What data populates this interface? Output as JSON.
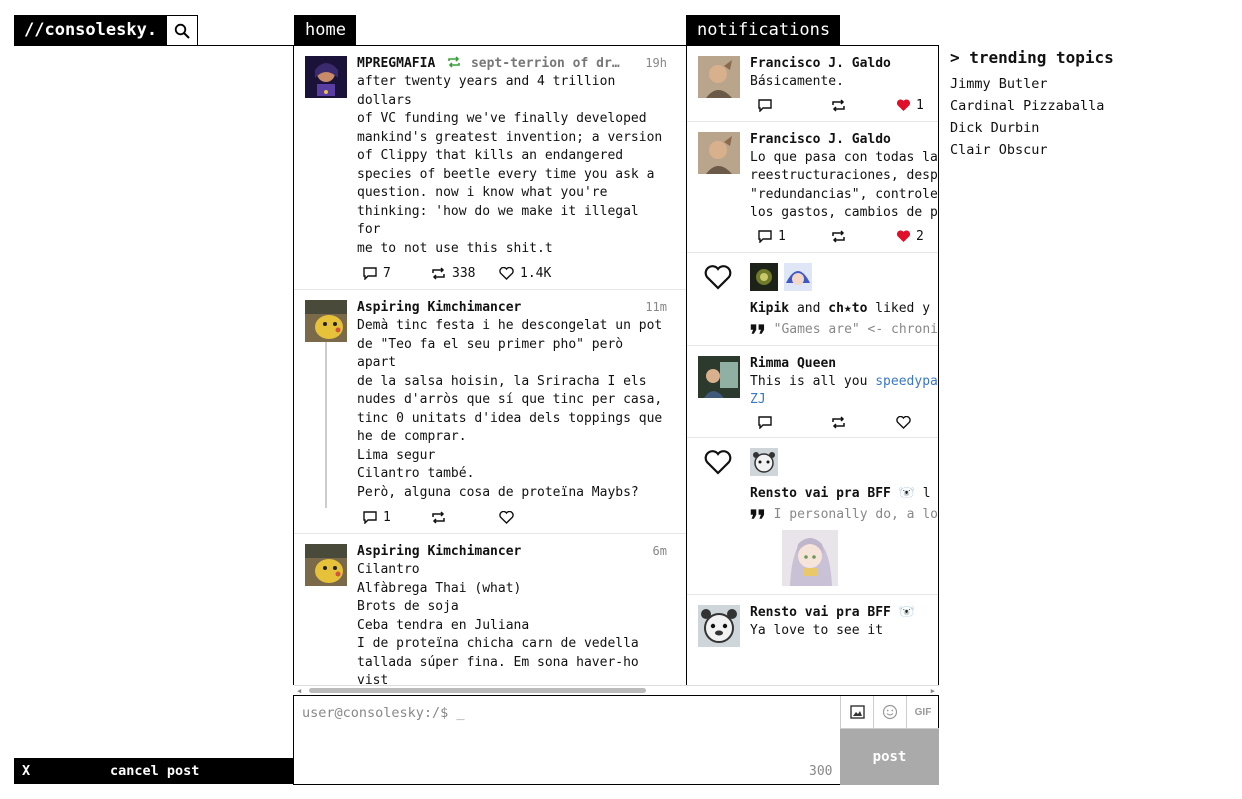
{
  "app": {
    "logo": "//consolesky."
  },
  "columns": {
    "home": "home",
    "notifications": "notifications"
  },
  "home": {
    "posts": [
      {
        "author": "MPREGMAFIA",
        "repost_by": "sept-terrion of dr…",
        "time": "19h",
        "body": "after twenty years and 4 trillion dollars\nof VC funding we've finally developed\nmankind's greatest invention; a version\nof Clippy that kills an endangered\nspecies of beetle every time you ask a\nquestion. now i know what you're\nthinking: 'how do we make it illegal for\nme to not use this shit.t",
        "replies": "7",
        "reposts": "338",
        "likes": "1.4K"
      },
      {
        "author": "Aspiring Kimchimancer",
        "time": "11m",
        "body": "Demà tinc festa i he descongelat un pot\nde \"Teo fa el seu primer pho\" però apart\nde la salsa hoisin, la Sriracha I els\nnudes d'arròs que sí que tinc per casa,\ntinc 0 unitats d'idea dels toppings que\nhe de comprar.\nLima segur\nCilantro també.\nPerò, alguna cosa de proteïna Maybs?",
        "replies": "1",
        "reposts": "",
        "likes": ""
      },
      {
        "author": "Aspiring Kimchimancer",
        "time": "6m",
        "body": "Cilantro\nAlfàbrega Thai (what)\nBrots de soja\nCeba tendra en Juliana\nI de proteïna chicha carn de vedella\ntallada súper fina. Em sona haver-ho vist\nen algún lloc.\nDe moment sembla fàcil.\nMenys per lo de l'alfabrega Thai."
      }
    ]
  },
  "notifications": {
    "items": [
      {
        "author": "Francisco J. Galdo",
        "text": "Básicamente.",
        "replies": "",
        "likes": "1"
      },
      {
        "author": "Francisco J. Galdo",
        "text": "Lo que pasa con todas las\nreestructuraciones, despi\n\"redundancias\", controles\nlos gastos, cambios de po",
        "replies": "1",
        "likes": "2"
      },
      {
        "user1": "Kipik",
        "and": "and",
        "user2": "ch★to",
        "action": "liked y",
        "quote": "\"Games are\" <- chroni"
      },
      {
        "author": "Rimma Queen",
        "text": "This is all you ",
        "link": "speedypape",
        "link2": "ZJ"
      },
      {
        "user1": "Rensto vai pra BFF 🐻‍❄️",
        "action": "l",
        "quote": "I personally do, a lo"
      },
      {
        "author": "Rensto vai pra BFF 🐻‍❄️",
        "text": "Ya love to see it"
      }
    ]
  },
  "trending": {
    "title": "> trending topics",
    "topics": [
      "Jimmy Butler",
      "Cardinal Pizzaballa",
      "Dick Durbin",
      "Clair Obscur"
    ]
  },
  "composer": {
    "placeholder": "user@consolesky:/$ _",
    "count": "300",
    "gif_label": "GIF",
    "post_label": "post"
  },
  "cancel": {
    "x": "X",
    "label": "cancel post"
  },
  "colors": {
    "like_red": "#e0102a",
    "repost_green": "#3aa13a",
    "link_blue": "#3a78c7"
  }
}
